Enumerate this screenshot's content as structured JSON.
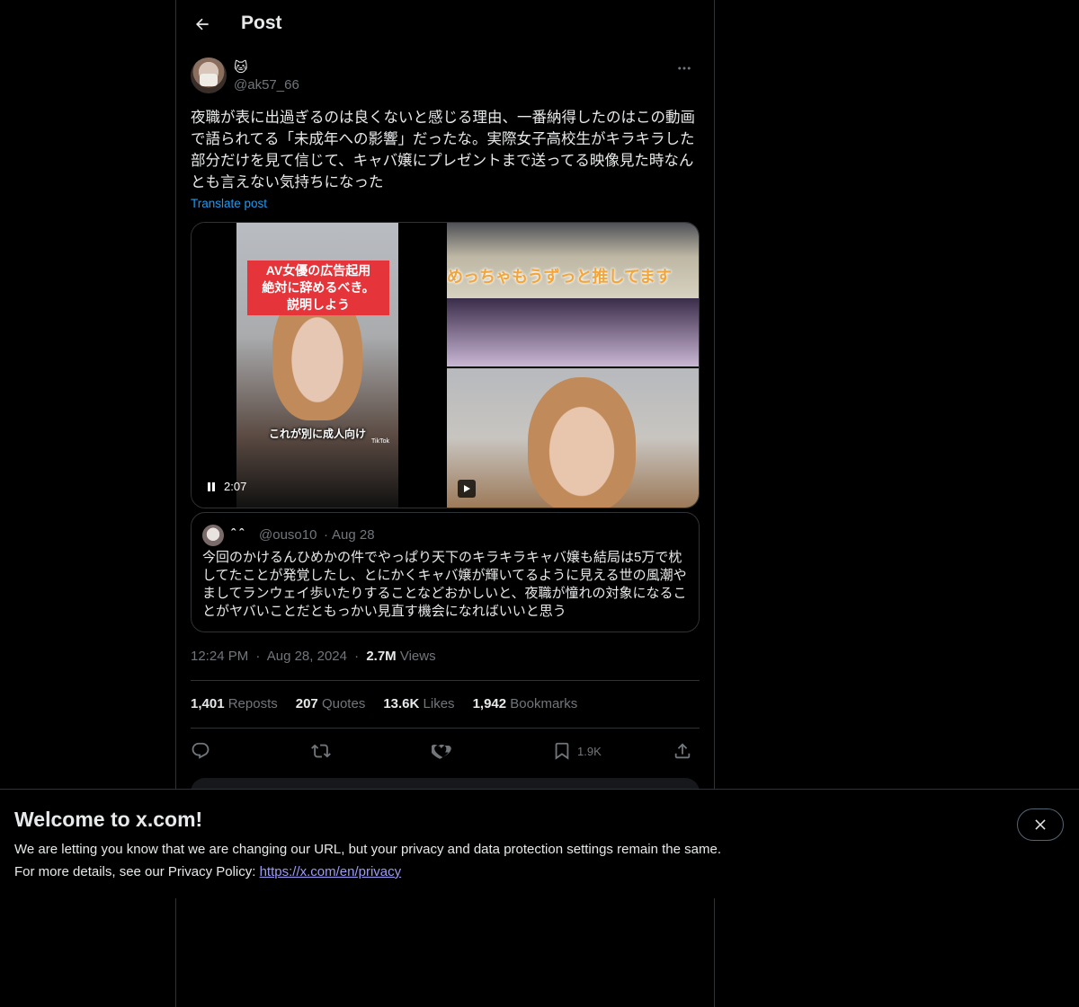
{
  "topbar": {
    "title": "Post"
  },
  "author": {
    "display_name": "🐱",
    "handle": "@ak57_66"
  },
  "post": {
    "text": "夜職が表に出過ぎるのは良くないと感じる理由、一番納得したのはこの動画で語られてる「未成年への影響」だったな。実際女子高校生がキラキラした部分だけを見て信じて、キャバ嬢にプレゼントまで送ってる映像見た時なんとも言えない気持ちになった",
    "translate_label": "Translate post"
  },
  "media": {
    "left_caption": "AV女優の広告起用\n絶対に辞めるべき。\n説明しよう",
    "left_subtitle": "これが別に成人向け",
    "tiktok_label": "TikTok",
    "duration": "2:07",
    "right_banner": "めっちゃもうずっと推してます"
  },
  "quote": {
    "name": "ˆ ˆ",
    "handle": "@ouso10",
    "separator": "·",
    "date": "Aug 28",
    "text": "今回のかけるんひめかの件でやっぱり天下のキラキラキャバ嬢も結局は5万で枕してたことが発覚したし、とにかくキャバ嬢が輝いてるように見える世の風潮やましてランウェイ歩いたりすることなどおかしいと、夜職が憧れの対象になることがヤバいことだともっかい見直す機会になればいいと思う"
  },
  "meta": {
    "time": "12:24 PM",
    "dot1": "·",
    "date": "Aug 28, 2024",
    "dot2": "·",
    "views_count": "2.7M",
    "views_label": "Views"
  },
  "stats": {
    "reposts_count": "1,401",
    "reposts_label": "Reposts",
    "quotes_count": "207",
    "quotes_label": "Quotes",
    "likes_count": "13.6K",
    "likes_label": "Likes",
    "bookmarks_count": "1,942",
    "bookmarks_label": "Bookmarks"
  },
  "actions": {
    "bookmark_count": "1.9K"
  },
  "banner": {
    "title": "Welcome to x.com!",
    "line1": "We are letting you know that we are changing our URL, but your privacy and data protection settings remain the same.",
    "line2_prefix": "For more details, see our Privacy Policy: ",
    "link": "https://x.com/en/privacy"
  },
  "colors": {
    "background": "#000000",
    "accent": "#1d9bf0",
    "muted": "#71767b",
    "border": "#2f3336"
  },
  "icons": [
    "back-arrow-icon",
    "more-icon",
    "pause-icon",
    "play-icon",
    "reply-icon",
    "repost-icon",
    "like-icon",
    "bookmark-icon",
    "share-icon",
    "close-icon"
  ]
}
